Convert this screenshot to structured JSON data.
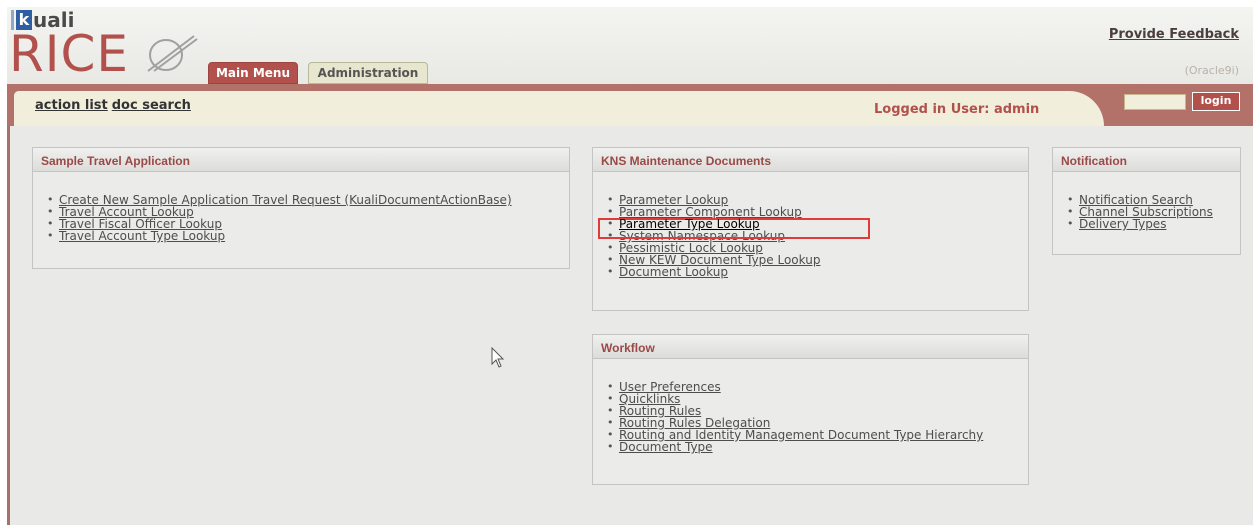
{
  "logo": {
    "kuali": "uali",
    "kuali_k": "k",
    "rice": "RICE"
  },
  "tabs": {
    "main_menu": "Main Menu",
    "administration": "Administration"
  },
  "header": {
    "feedback": "Provide Feedback",
    "db": "(Oracle9i)"
  },
  "toolbar": {
    "action_list": "action list",
    "doc_search": "doc search",
    "user": "Logged in User: admin"
  },
  "login": {
    "button": "login",
    "input_value": ""
  },
  "panels": {
    "travel": {
      "title": "Sample Travel Application",
      "items": [
        "Create New Sample Application Travel Request (KualiDocumentActionBase)",
        "Travel Account Lookup",
        "Travel Fiscal Officer Lookup",
        "Travel Account Type Lookup"
      ]
    },
    "kns": {
      "title": "KNS Maintenance Documents",
      "items": [
        "Parameter Lookup",
        "Parameter Component Lookup",
        "Parameter Type Lookup",
        "System Namespace Lookup",
        "Pessimistic Lock Lookup",
        "New KEW Document Type Lookup",
        "Document Lookup"
      ]
    },
    "notification": {
      "title": "Notification",
      "items": [
        "Notification Search",
        "Channel Subscriptions",
        "Delivery Types"
      ]
    },
    "workflow": {
      "title": "Workflow",
      "items": [
        "User Preferences",
        "Quicklinks",
        "Routing Rules",
        "Routing Rules Delegation",
        "Routing and Identity Management Document Type Hierarchy",
        "Document Type"
      ]
    }
  },
  "highlight_color": "#e03a3a",
  "accent_color": "#b2514c"
}
